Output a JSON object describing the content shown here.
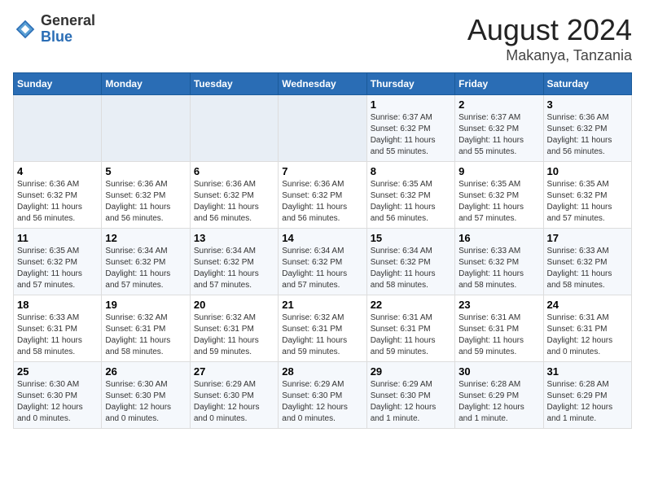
{
  "header": {
    "logo_general": "General",
    "logo_blue": "Blue",
    "main_title": "August 2024",
    "subtitle": "Makanya, Tanzania"
  },
  "days_of_week": [
    "Sunday",
    "Monday",
    "Tuesday",
    "Wednesday",
    "Thursday",
    "Friday",
    "Saturday"
  ],
  "weeks": [
    {
      "days": [
        {
          "num": "",
          "info": "",
          "empty": true
        },
        {
          "num": "",
          "info": "",
          "empty": true
        },
        {
          "num": "",
          "info": "",
          "empty": true
        },
        {
          "num": "",
          "info": "",
          "empty": true
        },
        {
          "num": "1",
          "info": "Sunrise: 6:37 AM\nSunset: 6:32 PM\nDaylight: 11 hours\nand 55 minutes.",
          "empty": false
        },
        {
          "num": "2",
          "info": "Sunrise: 6:37 AM\nSunset: 6:32 PM\nDaylight: 11 hours\nand 55 minutes.",
          "empty": false
        },
        {
          "num": "3",
          "info": "Sunrise: 6:36 AM\nSunset: 6:32 PM\nDaylight: 11 hours\nand 56 minutes.",
          "empty": false
        }
      ]
    },
    {
      "days": [
        {
          "num": "4",
          "info": "Sunrise: 6:36 AM\nSunset: 6:32 PM\nDaylight: 11 hours\nand 56 minutes.",
          "empty": false
        },
        {
          "num": "5",
          "info": "Sunrise: 6:36 AM\nSunset: 6:32 PM\nDaylight: 11 hours\nand 56 minutes.",
          "empty": false
        },
        {
          "num": "6",
          "info": "Sunrise: 6:36 AM\nSunset: 6:32 PM\nDaylight: 11 hours\nand 56 minutes.",
          "empty": false
        },
        {
          "num": "7",
          "info": "Sunrise: 6:36 AM\nSunset: 6:32 PM\nDaylight: 11 hours\nand 56 minutes.",
          "empty": false
        },
        {
          "num": "8",
          "info": "Sunrise: 6:35 AM\nSunset: 6:32 PM\nDaylight: 11 hours\nand 56 minutes.",
          "empty": false
        },
        {
          "num": "9",
          "info": "Sunrise: 6:35 AM\nSunset: 6:32 PM\nDaylight: 11 hours\nand 57 minutes.",
          "empty": false
        },
        {
          "num": "10",
          "info": "Sunrise: 6:35 AM\nSunset: 6:32 PM\nDaylight: 11 hours\nand 57 minutes.",
          "empty": false
        }
      ]
    },
    {
      "days": [
        {
          "num": "11",
          "info": "Sunrise: 6:35 AM\nSunset: 6:32 PM\nDaylight: 11 hours\nand 57 minutes.",
          "empty": false
        },
        {
          "num": "12",
          "info": "Sunrise: 6:34 AM\nSunset: 6:32 PM\nDaylight: 11 hours\nand 57 minutes.",
          "empty": false
        },
        {
          "num": "13",
          "info": "Sunrise: 6:34 AM\nSunset: 6:32 PM\nDaylight: 11 hours\nand 57 minutes.",
          "empty": false
        },
        {
          "num": "14",
          "info": "Sunrise: 6:34 AM\nSunset: 6:32 PM\nDaylight: 11 hours\nand 57 minutes.",
          "empty": false
        },
        {
          "num": "15",
          "info": "Sunrise: 6:34 AM\nSunset: 6:32 PM\nDaylight: 11 hours\nand 58 minutes.",
          "empty": false
        },
        {
          "num": "16",
          "info": "Sunrise: 6:33 AM\nSunset: 6:32 PM\nDaylight: 11 hours\nand 58 minutes.",
          "empty": false
        },
        {
          "num": "17",
          "info": "Sunrise: 6:33 AM\nSunset: 6:32 PM\nDaylight: 11 hours\nand 58 minutes.",
          "empty": false
        }
      ]
    },
    {
      "days": [
        {
          "num": "18",
          "info": "Sunrise: 6:33 AM\nSunset: 6:31 PM\nDaylight: 11 hours\nand 58 minutes.",
          "empty": false
        },
        {
          "num": "19",
          "info": "Sunrise: 6:32 AM\nSunset: 6:31 PM\nDaylight: 11 hours\nand 58 minutes.",
          "empty": false
        },
        {
          "num": "20",
          "info": "Sunrise: 6:32 AM\nSunset: 6:31 PM\nDaylight: 11 hours\nand 59 minutes.",
          "empty": false
        },
        {
          "num": "21",
          "info": "Sunrise: 6:32 AM\nSunset: 6:31 PM\nDaylight: 11 hours\nand 59 minutes.",
          "empty": false
        },
        {
          "num": "22",
          "info": "Sunrise: 6:31 AM\nSunset: 6:31 PM\nDaylight: 11 hours\nand 59 minutes.",
          "empty": false
        },
        {
          "num": "23",
          "info": "Sunrise: 6:31 AM\nSunset: 6:31 PM\nDaylight: 11 hours\nand 59 minutes.",
          "empty": false
        },
        {
          "num": "24",
          "info": "Sunrise: 6:31 AM\nSunset: 6:31 PM\nDaylight: 12 hours\nand 0 minutes.",
          "empty": false
        }
      ]
    },
    {
      "days": [
        {
          "num": "25",
          "info": "Sunrise: 6:30 AM\nSunset: 6:30 PM\nDaylight: 12 hours\nand 0 minutes.",
          "empty": false
        },
        {
          "num": "26",
          "info": "Sunrise: 6:30 AM\nSunset: 6:30 PM\nDaylight: 12 hours\nand 0 minutes.",
          "empty": false
        },
        {
          "num": "27",
          "info": "Sunrise: 6:29 AM\nSunset: 6:30 PM\nDaylight: 12 hours\nand 0 minutes.",
          "empty": false
        },
        {
          "num": "28",
          "info": "Sunrise: 6:29 AM\nSunset: 6:30 PM\nDaylight: 12 hours\nand 0 minutes.",
          "empty": false
        },
        {
          "num": "29",
          "info": "Sunrise: 6:29 AM\nSunset: 6:30 PM\nDaylight: 12 hours\nand 1 minute.",
          "empty": false
        },
        {
          "num": "30",
          "info": "Sunrise: 6:28 AM\nSunset: 6:29 PM\nDaylight: 12 hours\nand 1 minute.",
          "empty": false
        },
        {
          "num": "31",
          "info": "Sunrise: 6:28 AM\nSunset: 6:29 PM\nDaylight: 12 hours\nand 1 minute.",
          "empty": false
        }
      ]
    }
  ]
}
